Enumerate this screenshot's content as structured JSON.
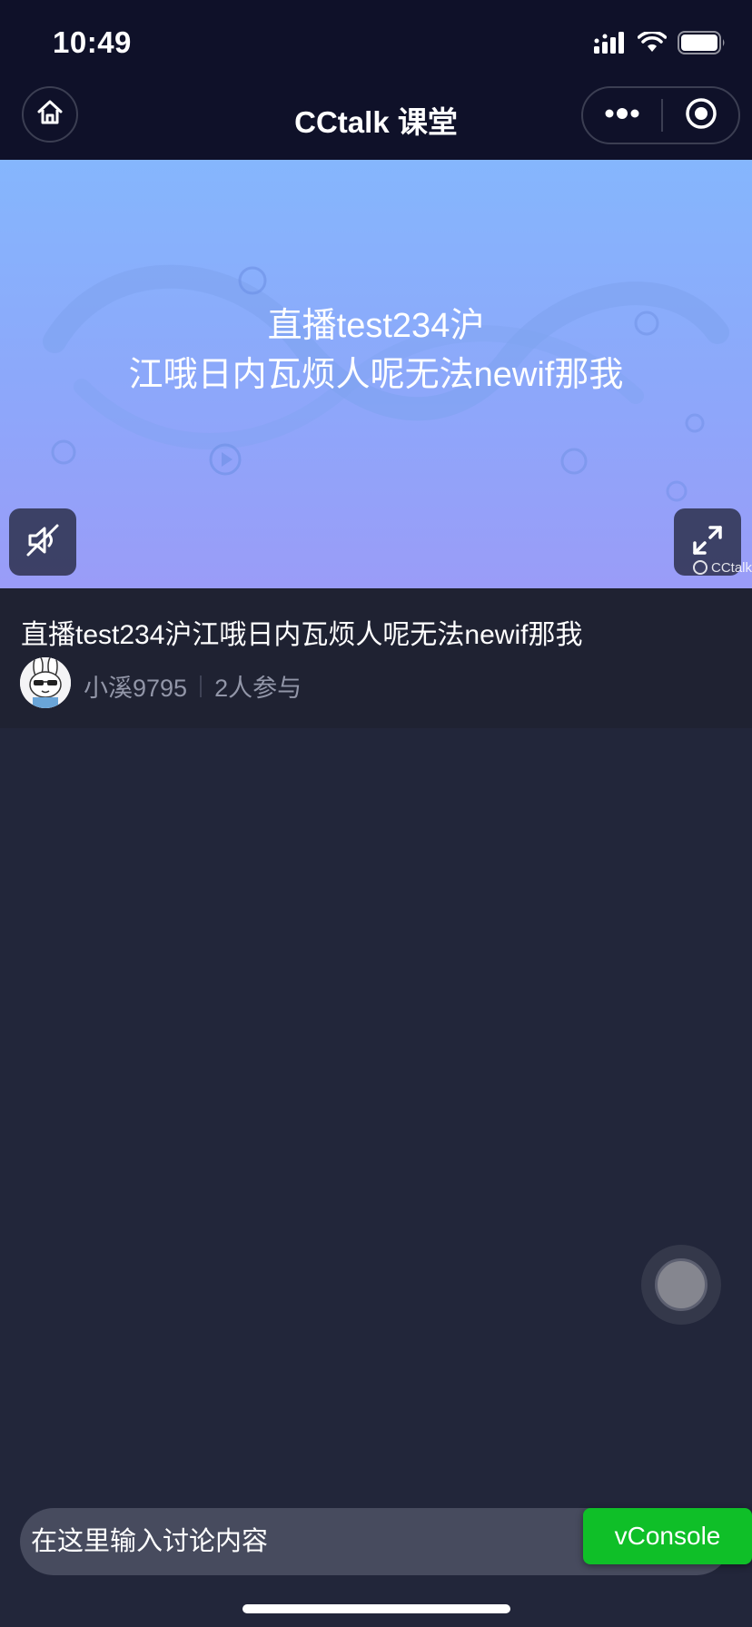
{
  "status_bar": {
    "time": "10:49",
    "icons": [
      "cellular-signal-icon",
      "wifi-icon",
      "battery-icon"
    ]
  },
  "nav": {
    "title": "CCtalk 课堂",
    "home_icon": "home-icon",
    "more_icon": "more-dots-icon",
    "close_icon": "record-close-icon"
  },
  "video": {
    "overlay_line1": "直播test234沪",
    "overlay_line2": "江哦日内瓦烦人呢无法newif那我",
    "mute_icon": "mute-icon",
    "fullscreen_icon": "fullscreen-icon",
    "watermark": "CCtalk"
  },
  "course": {
    "title": "直播test234沪江哦日内瓦烦人呢无法newif那我",
    "author": "小溪9795",
    "participants": "2人参与"
  },
  "chat": {
    "input_placeholder": "在这里输入讨论内容"
  },
  "vconsole": {
    "label": "vConsole"
  },
  "colors": {
    "top_bar": "#0f1129",
    "page_bg": "#22263a",
    "info_bg": "#1f2232",
    "video_gradient_top": "#85b6fd",
    "video_gradient_bottom": "#9a9cf8",
    "vconsole_green": "#0fbf28"
  }
}
